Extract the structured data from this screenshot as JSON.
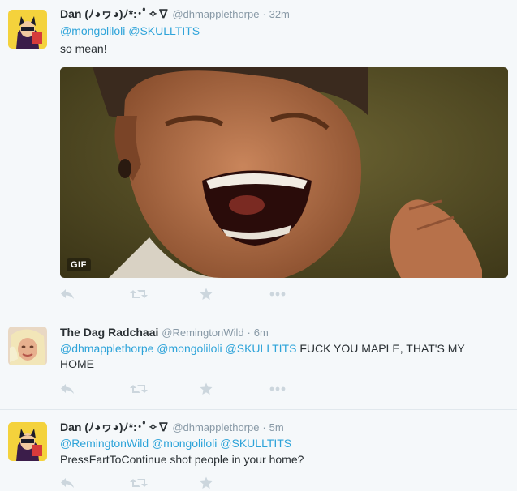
{
  "tweets": [
    {
      "fullname": "Dan (ﾉ◕ヮ◕)ﾉ*:･ﾟ✧∇",
      "username": "@dhmapplethorpe",
      "separator": "·",
      "time": "32m",
      "mentions": [
        "@mongoliloli",
        "@SKULLTITS"
      ],
      "text": "so mean!",
      "media": {
        "type": "gif",
        "badge": "GIF"
      }
    },
    {
      "fullname": "The Dag Radchaai",
      "username": "@RemingtonWild",
      "separator": "·",
      "time": "6m",
      "mentions": [
        "@dhmapplethorpe",
        "@mongoliloli",
        "@SKULLTITS"
      ],
      "text": "FUCK YOU MAPLE, THAT'S MY HOME"
    },
    {
      "fullname": "Dan (ﾉ◕ヮ◕)ﾉ*:･ﾟ✧∇",
      "username": "@dhmapplethorpe",
      "separator": "·",
      "time": "5m",
      "mentions": [
        "@RemingtonWild",
        "@mongoliloli",
        "@SKULLTITS"
      ],
      "text": "PressFartToContinue shot people in your home?"
    }
  ],
  "actions": [
    "reply-icon",
    "retweet-icon",
    "favorite-icon",
    "more-icon"
  ],
  "colors": {
    "mention": "#2da3d9",
    "meta": "#8899a6",
    "icon": "#ccd6dd",
    "background": "#f5f8fa"
  }
}
